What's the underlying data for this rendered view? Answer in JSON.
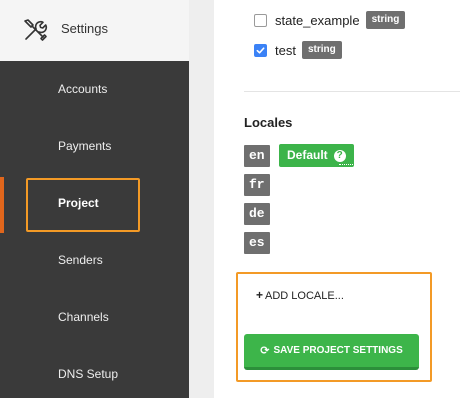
{
  "sidebar": {
    "header": {
      "icon": "tools-icon",
      "label": "Settings"
    },
    "items": [
      {
        "label": "Accounts",
        "active": false
      },
      {
        "label": "Payments",
        "active": false
      },
      {
        "label": "Project",
        "active": true
      },
      {
        "label": "Senders",
        "active": false
      },
      {
        "label": "Channels",
        "active": false
      },
      {
        "label": "DNS Setup",
        "active": false
      }
    ]
  },
  "fields": [
    {
      "name": "state_example",
      "type": "string",
      "checked": false
    },
    {
      "name": "test",
      "type": "string",
      "checked": true
    }
  ],
  "locales": {
    "title": "Locales",
    "items": [
      "en",
      "fr",
      "de",
      "es"
    ],
    "default_label": "Default",
    "help_icon": "?",
    "add_label": "ADD LOCALE..."
  },
  "actions": {
    "save_label": "SAVE PROJECT SETTINGS"
  },
  "colors": {
    "sidebar_bg": "#3a3a3a",
    "accent_orange": "#e0661c",
    "highlight_border": "#f39a26",
    "success_green": "#3db54a",
    "badge_gray": "#6f6f6f",
    "checkbox_blue": "#3b82f6"
  }
}
